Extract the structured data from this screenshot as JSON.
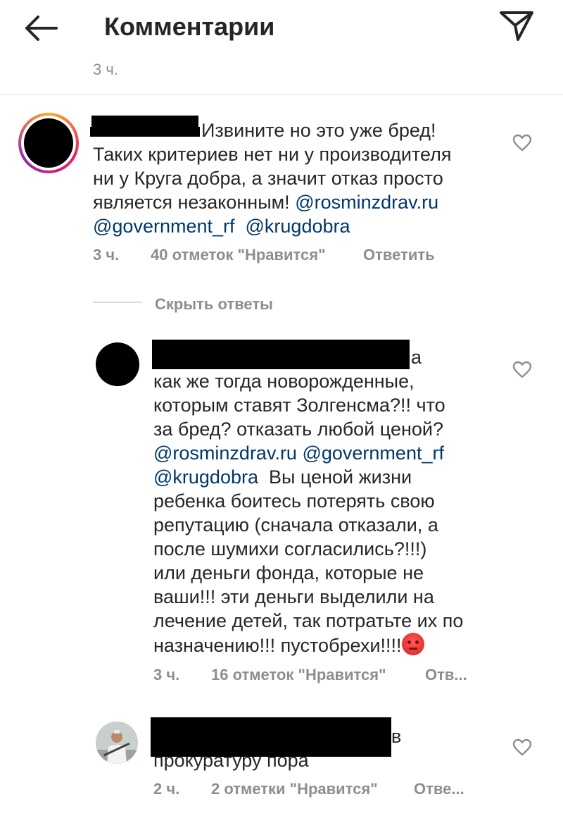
{
  "header": {
    "title": "Комментарии"
  },
  "top_timestamp": "3 ч.",
  "comments": [
    {
      "text_line1": "Извините но это уже бред!",
      "text_lines": [
        "Таких критериев нет ни у производителя",
        "ни у Круга добра, а значит отказ просто",
        "является  незаконным!"
      ],
      "mention_1": "@rosminzdrav.ru",
      "mention_2": "@government_rf",
      "mention_3": "@krugdobra",
      "time": "3 ч.",
      "likes": "40 отметок \"Нравится\"",
      "reply": "Ответить"
    }
  ],
  "hide_replies": "Скрыть ответы",
  "replies": [
    {
      "first_line_tail": "а",
      "lines": [
        "как же тогда новорожденные,",
        "которым ставят Золгенсма?!! что",
        "за бред? отказать любой ценой?"
      ],
      "mention_1": "@rosminzdrav.ru",
      "mention_2": "@government_rf",
      "mention_3": "@krugdobra",
      "after_mention": "Вы ценой жизни",
      "lines2": [
        "ребенка боитесь потерять свою",
        "репутацию (сначала отказали, а",
        "после шумихи согласились?!!!)",
        "или деньги фонда, которые не",
        "ваши!!! эти деньги выделили на",
        "лечение детей, так потратьте их по",
        "назначению!!! пустобрехи!!!!"
      ],
      "emoji": "angry-face",
      "time": "3 ч.",
      "likes": "16 отметок \"Нравится\"",
      "reply": "Отв..."
    },
    {
      "first_line_tail": "в",
      "lines": [
        "прокуратуру пора"
      ],
      "time": "2 ч.",
      "likes": "2 отметки \"Нравится\"",
      "reply": "Отве..."
    }
  ],
  "colors": {
    "text": "#262626",
    "muted": "#8e8e8e",
    "mention": "#00376b",
    "redaction": "#000000"
  },
  "icons": [
    "back-arrow-icon",
    "send-icon",
    "heart-icon"
  ]
}
